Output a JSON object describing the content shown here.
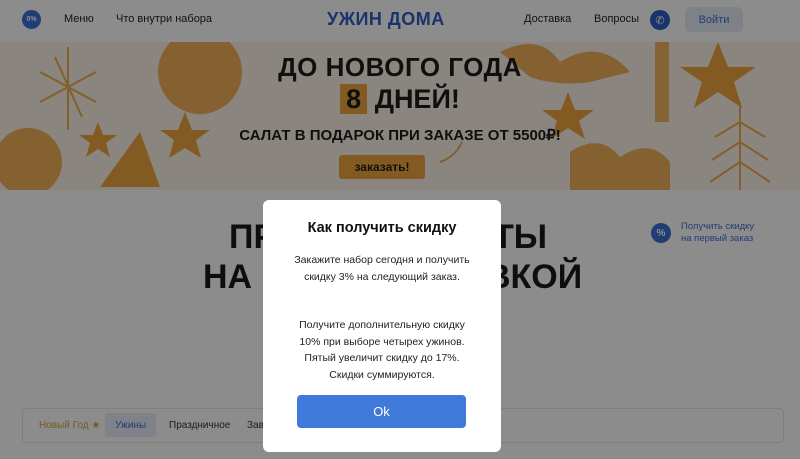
{
  "header": {
    "badge": "0%",
    "menu": "Меню",
    "inside": "Что внутри набора",
    "logo": "УЖИН ДОМА",
    "delivery": "Доставка",
    "questions": "Вопросы",
    "phone_icon": "phone-icon",
    "login": "Войти"
  },
  "banner": {
    "line1": "ДО НОВОГО ГОДА",
    "days_number": "8",
    "days_word": "ДНЕЙ!",
    "subtitle": "САЛАТ В ПОДАРОК ПРИ ЗАКАЗЕ ОТ 5500₽!",
    "button": "заказать!"
  },
  "main": {
    "title_line1": "ПР",
    "title_line1_end": "ТЫ",
    "title_line2": "НА Н",
    "title_line2_end": "ВКОЙ",
    "promo_icon": "%",
    "promo_line1": "Получить скидку",
    "promo_line2": "на первый заказ"
  },
  "tabs": {
    "new_year": "Новый Год ★",
    "dinners": "Ужины",
    "festive": "Праздничное",
    "partial": "Завт"
  },
  "modal": {
    "title": "Как получить скидку",
    "para1": "Закажите набор сегодня и получить скидку 3% на следующий заказ.",
    "para2": "Получите дополнительную скидку 10% при выборе четырех ужинов. Пятый увеличит скидку до 17%. Скидки суммируются.",
    "ok": "Ok"
  },
  "colors": {
    "accent": "#3d6fd6",
    "orange": "#f0a540"
  }
}
